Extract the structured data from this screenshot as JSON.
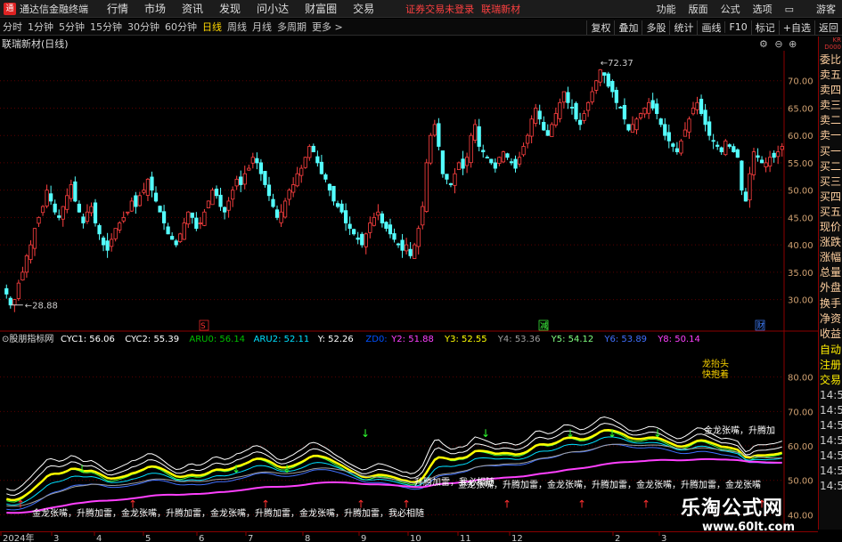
{
  "app": {
    "name": "通达信金融终端"
  },
  "menu": [
    {
      "label": "行情"
    },
    {
      "label": "市场"
    },
    {
      "label": "资讯"
    },
    {
      "label": "发现"
    },
    {
      "label": "问小达"
    },
    {
      "label": "财富圈"
    },
    {
      "label": "交易"
    }
  ],
  "status_warning": "证券交易未登录",
  "stock_name_menu": "联瑞新材",
  "right_menu": [
    {
      "label": "功能"
    },
    {
      "label": "版面"
    },
    {
      "label": "公式"
    },
    {
      "label": "选项"
    }
  ],
  "user": "游客",
  "periods": [
    {
      "label": "分时"
    },
    {
      "label": "1分钟"
    },
    {
      "label": "5分钟"
    },
    {
      "label": "15分钟"
    },
    {
      "label": "30分钟"
    },
    {
      "label": "60分钟"
    },
    {
      "label": "日线",
      "active": true
    },
    {
      "label": "周线"
    },
    {
      "label": "月线"
    },
    {
      "label": "多周期"
    },
    {
      "label": "更多 >"
    }
  ],
  "tools": [
    {
      "label": "复权"
    },
    {
      "label": "叠加"
    },
    {
      "label": "多股"
    },
    {
      "label": "统计"
    },
    {
      "label": "画线"
    },
    {
      "label": "F10"
    },
    {
      "label": "标记"
    },
    {
      "label": "+自选"
    },
    {
      "label": "返回"
    }
  ],
  "chart_title": "联瑞新材(日线)",
  "right_column": {
    "head": "KR\nD000",
    "items": [
      "委比",
      "卖五",
      "卖四",
      "卖三",
      "卖二",
      "卖一",
      "买一",
      "买二",
      "买三",
      "买四",
      "买五",
      "现价",
      "涨跌",
      "涨幅",
      "总量",
      "外盘",
      "换手",
      "净资",
      "收益"
    ]
  },
  "right_column2": {
    "items": [
      "自动",
      "注册",
      "交易"
    ],
    "times": [
      "14:5",
      "14:5",
      "14:5",
      "14:5",
      "14:5",
      "14:5",
      "14:5"
    ]
  },
  "indicator": {
    "name": "股朋指标网",
    "values": [
      {
        "label": "CYC1: 56.06",
        "color": "#ffffff"
      },
      {
        "label": "CYC2: 55.39",
        "color": "#ffffff"
      },
      {
        "label": "ARU0: 56.14",
        "color": "#00c000"
      },
      {
        "label": "ARU2: 52.11",
        "color": "#00e0ff"
      },
      {
        "label": "Y: 52.26",
        "color": "#ffffff"
      },
      {
        "label": "ZD0:",
        "color": "#0050ff"
      },
      {
        "label": "Y2: 51.88",
        "color": "#ff40ff"
      },
      {
        "label": "Y3: 52.55",
        "color": "#ffff00"
      },
      {
        "label": "Y4: 53.36",
        "color": "#a0a0a0"
      },
      {
        "label": "Y5: 54.12",
        "color": "#80ff80"
      },
      {
        "label": "Y6: 53.89",
        "color": "#4070ff"
      },
      {
        "label": "Y8: 50.14",
        "color": "#ff40ff"
      }
    ]
  },
  "signal_texts": [
    "金龙张嘴",
    "升腾加雷",
    "我必相随",
    "龙抬头",
    "快抱着"
  ],
  "marker_s": "S",
  "marker_jian": "减",
  "marker_cai": "财",
  "watermark": {
    "cn": "乐淘公式网",
    "en": "www.60lt.com"
  },
  "x_labels": [
    "2024年",
    "3",
    "4",
    "5",
    "6",
    "7",
    "8",
    "9",
    "10",
    "11",
    "12",
    "2",
    "3"
  ],
  "chart_data": [
    {
      "type": "candlestick",
      "title": "联瑞新材(日线)",
      "ylim": [
        27,
        75
      ],
      "yticks": [
        30,
        35,
        40,
        45,
        50,
        55,
        60,
        65,
        70
      ],
      "annotations": [
        {
          "label": "28.88",
          "type": "low"
        },
        {
          "label": "72.37",
          "type": "high"
        }
      ],
      "closes": [
        31,
        29,
        30,
        33,
        35,
        38,
        40,
        43,
        45,
        47,
        50,
        48,
        46,
        45,
        47,
        49,
        51,
        48,
        46,
        44,
        46,
        47,
        44,
        42,
        40,
        39,
        41,
        43,
        44,
        45,
        46,
        48,
        47,
        49,
        50,
        52,
        50,
        48,
        46,
        44,
        42,
        41,
        40,
        42,
        44,
        46,
        45,
        43,
        44,
        46,
        48,
        50,
        49,
        47,
        46,
        48,
        50,
        52,
        51,
        53,
        54,
        56,
        55,
        53,
        51,
        49,
        47,
        45,
        46,
        48,
        50,
        51,
        53,
        54,
        56,
        58,
        57,
        55,
        53,
        52,
        50,
        48,
        47,
        46,
        44,
        43,
        42,
        41,
        40,
        42,
        44,
        45,
        46,
        44,
        43,
        42,
        41,
        40,
        39,
        40,
        38,
        40,
        43,
        47,
        55,
        60,
        62,
        58,
        53,
        52,
        51,
        53,
        55,
        54,
        56,
        60,
        62,
        58,
        57,
        56,
        55,
        54,
        56,
        57,
        56,
        55,
        54,
        56,
        58,
        60,
        63,
        65,
        63,
        61,
        60,
        62,
        64,
        66,
        68,
        66,
        65,
        63,
        62,
        64,
        66,
        68,
        70,
        72,
        71,
        69,
        68,
        66,
        65,
        63,
        61,
        62,
        63,
        64,
        65,
        66,
        65,
        64,
        62,
        60,
        59,
        58,
        57,
        59,
        61,
        63,
        65,
        66,
        64,
        62,
        60,
        59,
        58,
        57,
        59,
        58,
        57,
        56,
        50,
        48,
        53,
        57,
        56,
        55,
        55,
        56,
        56,
        57,
        58
      ]
    },
    {
      "type": "line",
      "title": "股朋指标网",
      "ylim": [
        37,
        90
      ],
      "yticks": [
        40,
        50,
        60,
        70,
        80
      ]
    }
  ]
}
